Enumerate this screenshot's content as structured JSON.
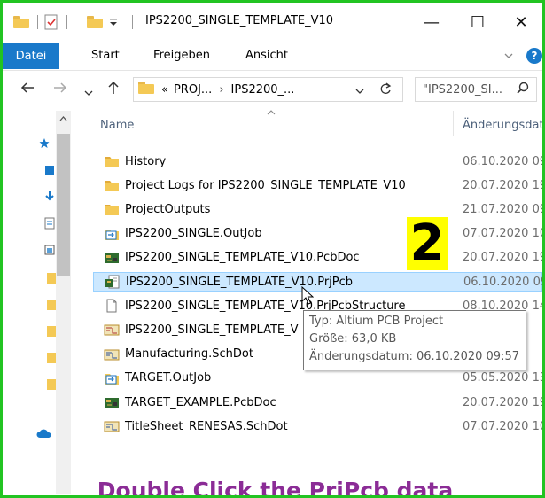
{
  "window": {
    "title": "IPS2200_SINGLE_TEMPLATE_V10",
    "minimize_glyph": "—",
    "maximize_glyph": "☐",
    "close_glyph": "✕"
  },
  "ribbon": {
    "file_tab": "Datei",
    "tabs": [
      "Start",
      "Freigeben",
      "Ansicht"
    ],
    "help": "?"
  },
  "address": {
    "path_prefix": "«",
    "crumb_1": "PROJ...",
    "crumb_sep": "›",
    "crumb_2": "IPS2200_...",
    "search_placeholder": "\"IPS2200_SI..."
  },
  "columns": {
    "name": "Name",
    "date": "Änderungsdat"
  },
  "files": [
    {
      "name": "History",
      "date": "06.10.2020 09:5",
      "icon": "folder-icon"
    },
    {
      "name": "Project Logs for IPS2200_SINGLE_TEMPLATE_V10",
      "date": "20.07.2020 19:",
      "icon": "folder-icon"
    },
    {
      "name": "ProjectOutputs",
      "date": "21.07.2020 09:2",
      "icon": "folder-icon"
    },
    {
      "name": "IPS2200_SINGLE.OutJob",
      "date": "07.07.2020 10:2",
      "icon": "outjob-icon"
    },
    {
      "name": "IPS2200_SINGLE_TEMPLATE_V10.PcbDoc",
      "date": "20.07.2020 19:2",
      "icon": "pcbdoc-icon"
    },
    {
      "name": "IPS2200_SINGLE_TEMPLATE_V10.PrjPcb",
      "date": "06.10.2020 09:5",
      "icon": "prjpcb-icon",
      "selected": true
    },
    {
      "name": "IPS2200_SINGLE_TEMPLATE_V10.PrjPcbStructure",
      "date": "08.10.2020 14:3",
      "icon": "blank-file-icon"
    },
    {
      "name": "IPS2200_SINGLE_TEMPLATE_V",
      "date": "19:",
      "icon": "schdoc-icon"
    },
    {
      "name": "Manufacturing.SchDot",
      "date": "21:",
      "icon": "schdot-icon"
    },
    {
      "name": "TARGET.OutJob",
      "date": "05.05.2020 13:",
      "icon": "outjob-icon"
    },
    {
      "name": "TARGET_EXAMPLE.PcbDoc",
      "date": "20.07.2020 19:2",
      "icon": "pcbdoc-icon"
    },
    {
      "name": "TitleSheet_RENESAS.SchDot",
      "date": "07.07.2020 10:",
      "icon": "schdot-icon"
    }
  ],
  "tooltip": {
    "type_line": "Typ: Altium PCB Project",
    "size_line": "Größe: 63,0 KB",
    "date_line": "Änderungsdatum: 06.10.2020 09:57"
  },
  "annotation": {
    "step_number": "2",
    "caption": "Double Click the PrjPcb data"
  },
  "colors": {
    "frame_border": "#22c422",
    "file_tab": "#1979ca",
    "selection": "#cce8ff",
    "badge": "#ffff00",
    "caption": "#8b2c96"
  }
}
